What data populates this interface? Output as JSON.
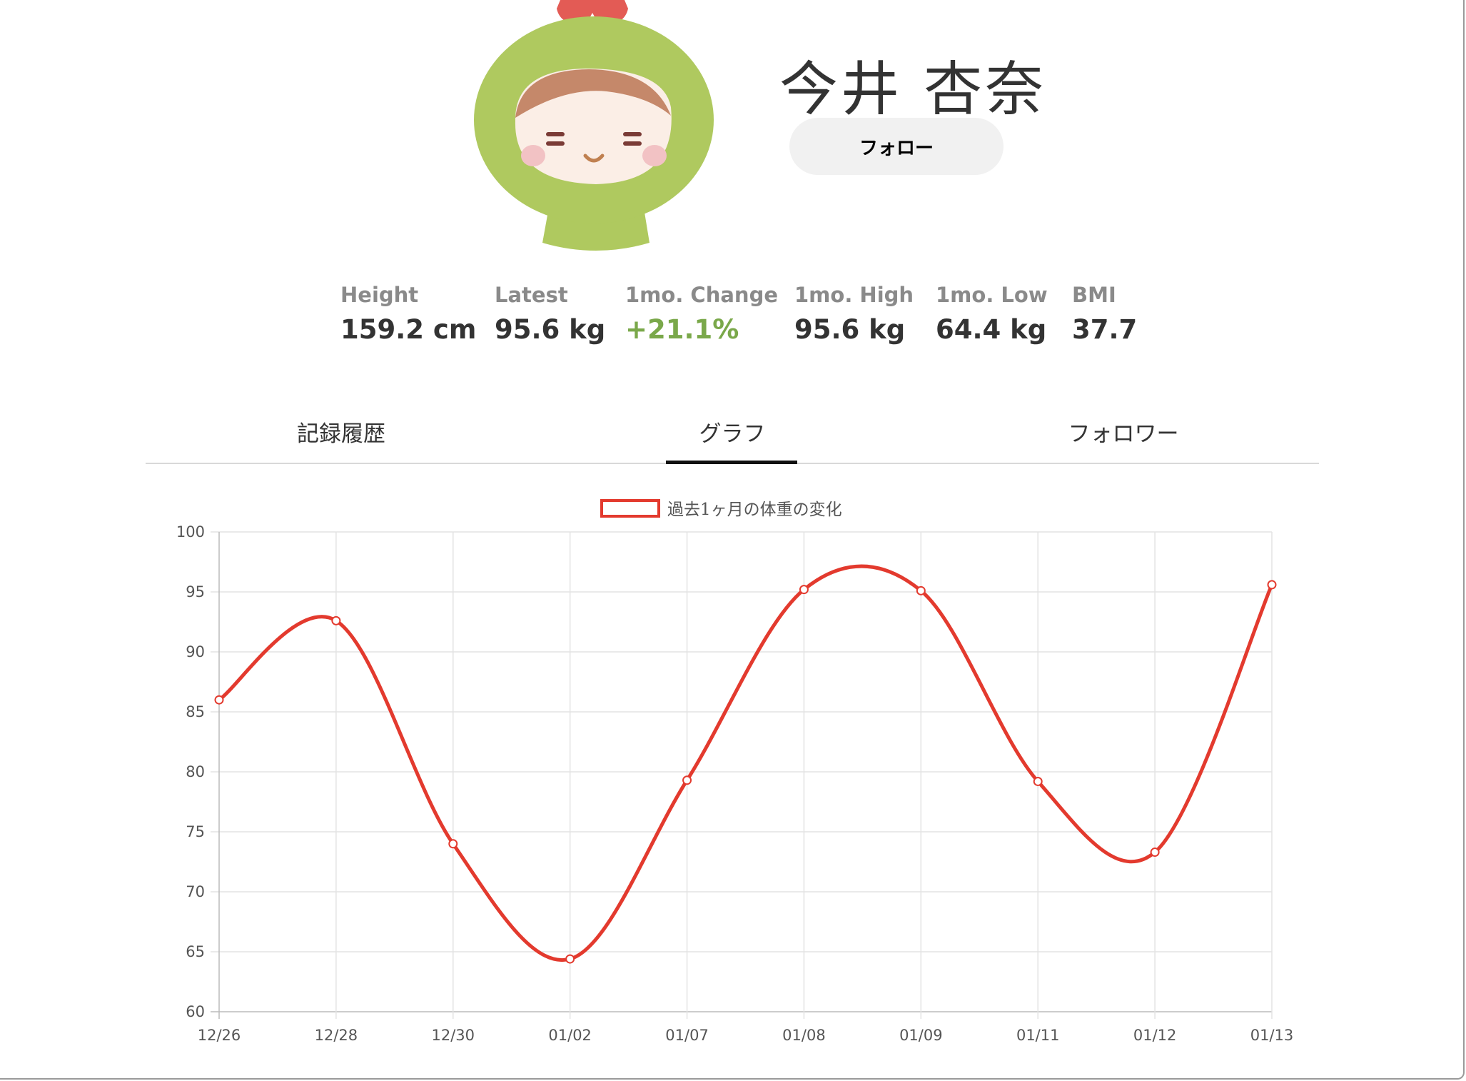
{
  "profile": {
    "name": "今井 杏奈",
    "follow_label": "フォロー"
  },
  "stats": [
    {
      "label": "Height",
      "value": "159.2 cm"
    },
    {
      "label": "Latest",
      "value": "95.6 kg"
    },
    {
      "label": "1mo. Change",
      "value": "+21.1%"
    },
    {
      "label": "1mo. High",
      "value": "95.6 kg"
    },
    {
      "label": "1mo. Low",
      "value": "64.4 kg"
    },
    {
      "label": "BMI",
      "value": "37.7"
    }
  ],
  "tabs": [
    {
      "label": "記録履歴"
    },
    {
      "label": "グラフ"
    },
    {
      "label": "フォロワー"
    }
  ],
  "active_tab": "グラフ",
  "colors": {
    "accent": "#e33a2e",
    "positive": "#7aa84a",
    "avatar_hood": "#afc95f",
    "avatar_flower": "#e35b55"
  },
  "chart_data": {
    "type": "line",
    "x": [
      "12/26",
      "12/28",
      "12/30",
      "01/02",
      "01/07",
      "01/08",
      "01/09",
      "01/11",
      "01/12",
      "01/13"
    ],
    "series": [
      {
        "name": "過去1ヶ月の体重の変化",
        "values": [
          86.0,
          92.6,
          74.0,
          64.4,
          79.3,
          95.2,
          95.1,
          79.2,
          73.3,
          95.6
        ]
      }
    ],
    "ylim": [
      60,
      100
    ],
    "yticks": [
      60,
      65,
      70,
      75,
      80,
      85,
      90,
      95,
      100
    ],
    "grid": true,
    "legend": "top-center",
    "smooth": true
  }
}
